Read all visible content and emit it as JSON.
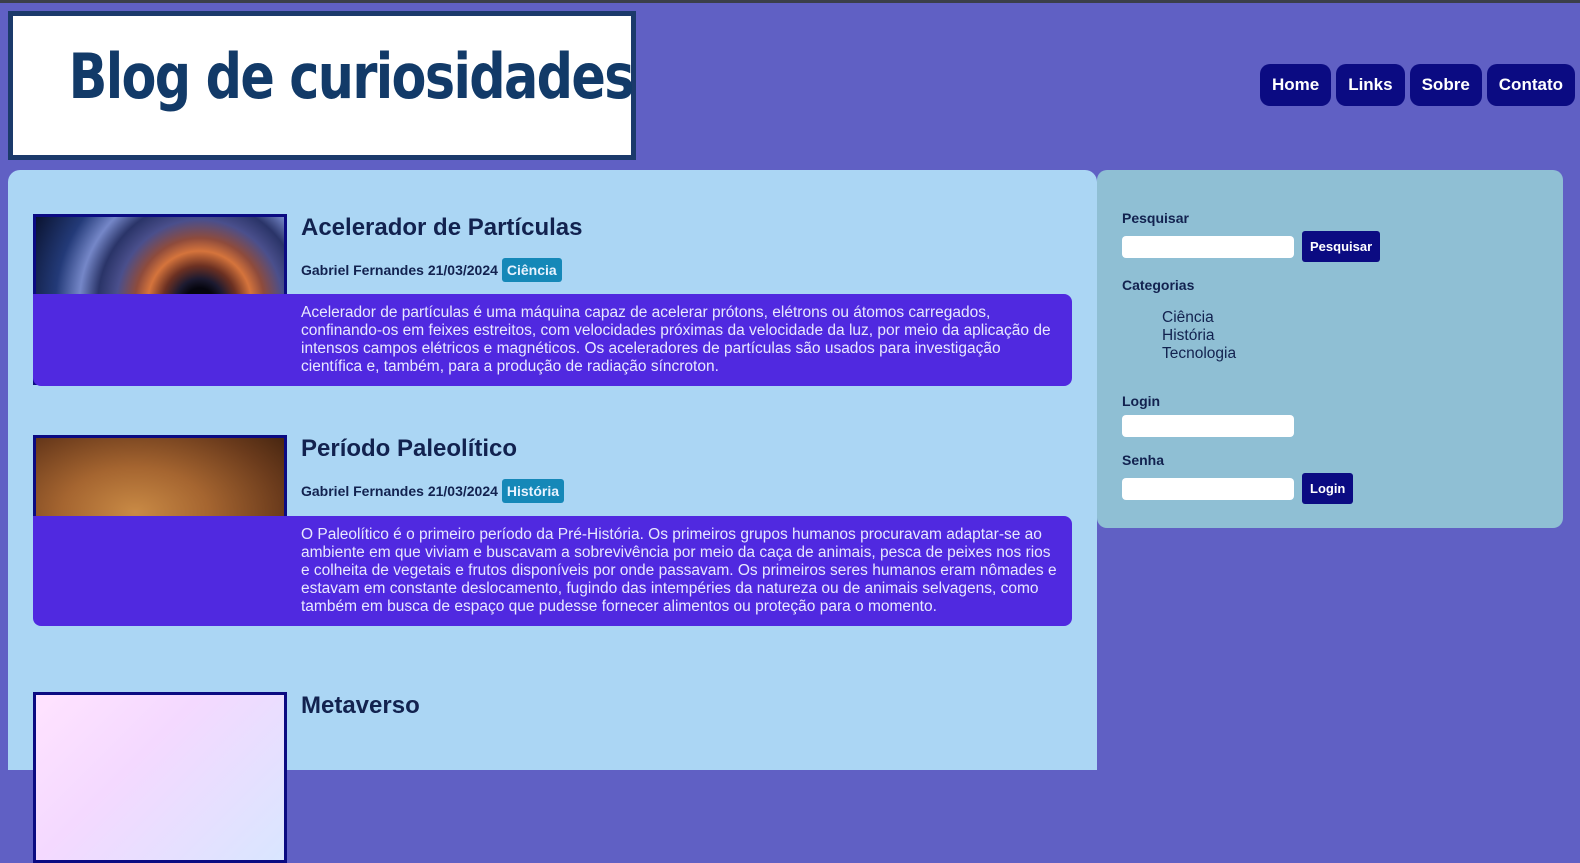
{
  "header": {
    "title": "Blog de curiosidades"
  },
  "nav": [
    "Home",
    "Links",
    "Sobre",
    "Contato"
  ],
  "posts": [
    {
      "title": "Acelerador de Partículas",
      "author_date": "Gabriel Fernandes 21/03/2024",
      "category": "Ciência",
      "body": "Acelerador de partículas é uma máquina capaz de acelerar prótons, elétrons ou átomos carregados, confinando-os em feixes estreitos, com velocidades próximas da velocidade da luz, por meio da aplicação de intensos campos elétricos e magnéticos. Os aceleradores de partículas são usados para investigação científica e, também, para a produção de radiação síncroton."
    },
    {
      "title": "Período Paleolítico",
      "author_date": "Gabriel Fernandes 21/03/2024",
      "category": "História",
      "body": "O Paleolítico é o primeiro período da Pré-História. Os primeiros grupos humanos procuravam adaptar-se ao ambiente em que viviam e buscavam a sobrevivência por meio da caça de animais, pesca de peixes nos rios e colheita de vegetais e frutos disponíveis por onde passavam. Os primeiros seres humanos eram nômades e estavam em constante deslocamento, fugindo das intempéries da natureza ou de animais selvagens, como também em busca de espaço que pudesse fornecer alimentos ou proteção para o momento."
    },
    {
      "title": "Metaverso"
    }
  ],
  "sidebar": {
    "search_label": "Pesquisar",
    "search_value": "",
    "search_button": "Pesquisar",
    "categories_label": "Categorias",
    "categories": [
      "Ciência",
      "História",
      "Tecnologia"
    ],
    "login_label": "Login",
    "login_value": "",
    "password_label": "Senha",
    "password_value": "",
    "login_button": "Login"
  }
}
